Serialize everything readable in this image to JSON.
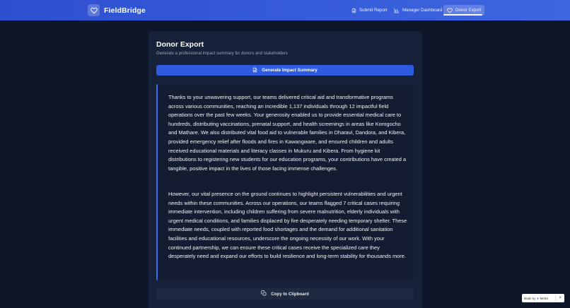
{
  "app": {
    "name": "FieldBridge"
  },
  "nav": {
    "items": [
      {
        "label": "Submit Report",
        "icon": "document-icon"
      },
      {
        "label": "Manager Dashboard",
        "icon": "bar-chart-icon"
      },
      {
        "label": "Donor Export",
        "icon": "heart-icon",
        "active": true
      }
    ]
  },
  "page": {
    "title": "Donor Export",
    "subtitle": "Generate a professional impact summary for donors and stakeholders",
    "generate_label": "Generate Impact Summary",
    "copy_label": "Copy to Clipboard"
  },
  "summary": {
    "paragraphs": [
      "Thanks to your unwavering support, our teams delivered critical aid and transformative programs across various communities, reaching an incredible 1,137 individuals through 12 impactful field operations over the past few weeks. Your generosity enabled us to provide essential medical care to hundreds, distributing vaccinations, prenatal support, and health screenings in areas like Korogocho and Mathare. We also distributed vital food aid to vulnerable families in Dharavi, Dandora, and Kibera, provided emergency relief after floods and fires in Kawangware, and ensured children and adults received educational materials and literacy classes in Mukuru and Kibera. From hygiene kit distributions to registering new students for our education programs, your contributions have created a tangible, positive impact in the lives of those facing immense challenges.",
      "However, our vital presence on the ground continues to highlight persistent vulnerabilities and urgent needs within these communities. Across our operations, our teams flagged 7 critical cases requiring immediate intervention, including children suffering from severe malnutrition, elderly individuals with urgent medical conditions, and families displaced by fire desperately needing temporary shelter. These immediate needs, coupled with reported food shortages and the demand for additional sanitation facilities and educational resources, underscore the ongoing necessity of our work. With your continued partnership, we can ensure these critical cases receive the specialized care they desperately need and expand our efforts to build resilience and long-term stability for thousands more."
    ]
  },
  "badge": {
    "made_by": "Made by",
    "brand": "MeDo"
  },
  "colors": {
    "accent": "#2f5be0",
    "header": "#3b5fdb",
    "background": "#0f1629",
    "card": "#18213a",
    "quote_border": "#3b6cf0"
  }
}
